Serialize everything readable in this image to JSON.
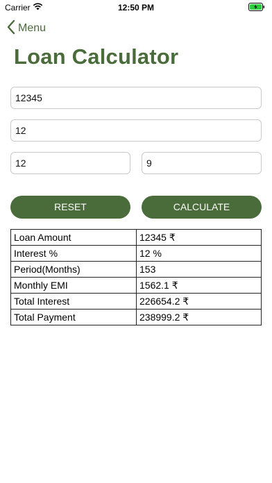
{
  "status_bar": {
    "carrier": "Carrier",
    "time": "12:50 PM"
  },
  "nav": {
    "back_label": "Menu"
  },
  "title": "Loan Calculator",
  "inputs": {
    "amount": "12345",
    "rate": "12",
    "years": "12",
    "months": "9"
  },
  "buttons": {
    "reset": "RESET",
    "calculate": "CALCULATE"
  },
  "results": [
    {
      "label": "Loan Amount",
      "value": "12345 ₹"
    },
    {
      "label": "Interest %",
      "value": "12 %"
    },
    {
      "label": "Period(Months)",
      "value": "153"
    },
    {
      "label": "Monthly EMI",
      "value": "1562.1 ₹"
    },
    {
      "label": "Total Interest",
      "value": "226654.2 ₹"
    },
    {
      "label": "Total Payment",
      "value": "238999.2 ₹"
    }
  ],
  "colors": {
    "accent": "#4a6b3a",
    "button_text": "#ffffff"
  },
  "icons": {
    "wifi": "wifi-icon",
    "battery": "battery-charging-icon",
    "back": "chevron-left-icon"
  }
}
